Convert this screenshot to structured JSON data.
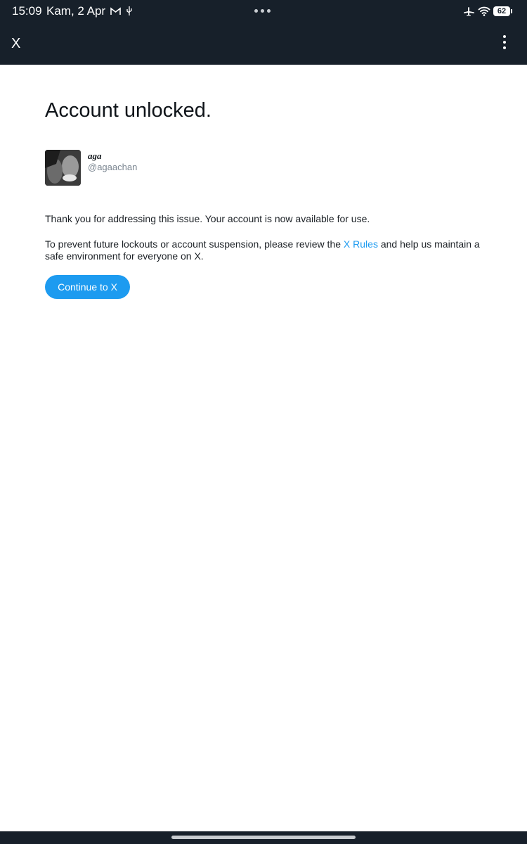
{
  "status_bar": {
    "time": "15:09",
    "date": "Kam, 2 Apr",
    "battery": "62",
    "icons": [
      "gmail-icon",
      "usb-icon",
      "more-dots-icon",
      "airplane-mode-icon",
      "wifi-icon",
      "battery-icon"
    ]
  },
  "app_bar": {
    "title": "X",
    "menu_icon": "more-vertical-icon"
  },
  "main": {
    "heading": "Account unlocked.",
    "user": {
      "name": "aga",
      "handle": "@agaachan"
    },
    "message_1": "Thank you for addressing this issue. Your account is now available for use.",
    "message_2_before": "To prevent future lockouts or account suspension, please review the ",
    "message_2_link": "X Rules",
    "message_2_after": " and help us maintain a safe environment for everyone on X.",
    "continue_button": "Continue to X"
  },
  "colors": {
    "topbar_bg": "#17202a",
    "accent": "#1d9bf0",
    "text": "#0f1419",
    "muted": "#7a8590"
  }
}
